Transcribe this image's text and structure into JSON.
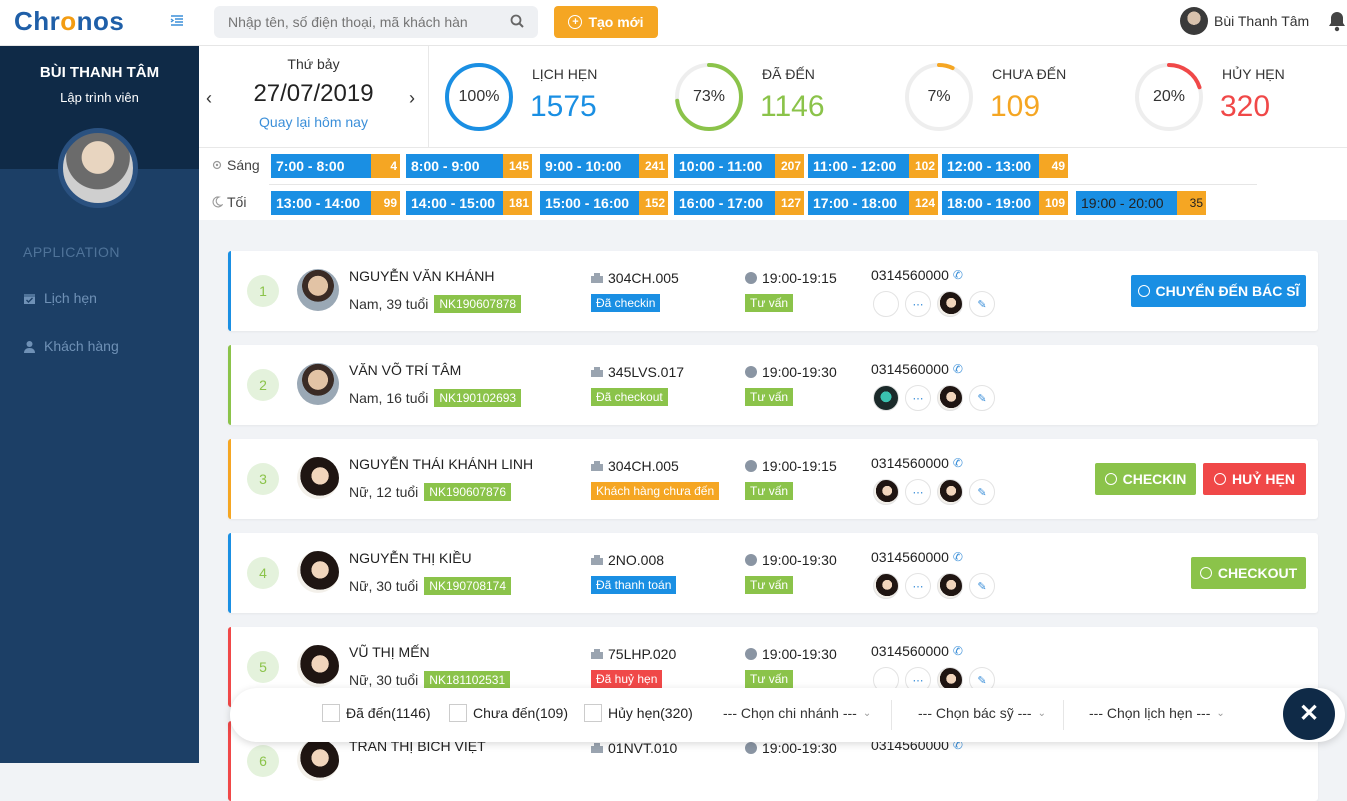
{
  "topbar": {
    "logo_pre": "Chr",
    "logo_o": "o",
    "logo_post": "nos",
    "search_placeholder": "Nhập tên, số điện thoại, mã khách hàn",
    "create_label": "Tạo mới",
    "user_name": "Bùi Thanh Tâm"
  },
  "sidebar": {
    "profile_name": "BÙI THANH TÂM",
    "profile_role": "Lập trình viên",
    "section": "APPLICATION",
    "items": [
      {
        "label": "Lịch hẹn",
        "icon": "calendar-icon"
      },
      {
        "label": "Khách hàng",
        "icon": "user-icon"
      }
    ]
  },
  "date": {
    "day_label": "Thứ bảy",
    "value": "27/07/2019",
    "back_label": "Quay lại hôm nay"
  },
  "stats": [
    {
      "title": "LỊCH HẸN",
      "value": "1575",
      "pct": 100,
      "pct_label": "100%",
      "color": "#1a8fe3"
    },
    {
      "title": "ĐÃ ĐẾN",
      "value": "1146",
      "pct": 73,
      "pct_label": "73%",
      "color": "#8bc34a"
    },
    {
      "title": "CHƯA ĐẾN",
      "value": "109",
      "pct": 7,
      "pct_label": "7%",
      "color": "#f5a623"
    },
    {
      "title": "HỦY HẸN",
      "value": "320",
      "pct": 20,
      "pct_label": "20%",
      "color": "#f04848"
    }
  ],
  "timeslots": {
    "morning_label": "Sáng",
    "evening_label": "Tối",
    "morning": [
      {
        "time": "7:00 - 8:00",
        "count": "4"
      },
      {
        "time": "8:00 - 9:00",
        "count": "145"
      },
      {
        "time": "9:00 - 10:00",
        "count": "241"
      },
      {
        "time": "10:00 - 11:00",
        "count": "207"
      },
      {
        "time": "11:00 - 12:00",
        "count": "102"
      },
      {
        "time": "12:00 - 13:00",
        "count": "49"
      }
    ],
    "evening": [
      {
        "time": "13:00 - 14:00",
        "count": "99"
      },
      {
        "time": "14:00 - 15:00",
        "count": "181"
      },
      {
        "time": "15:00 - 16:00",
        "count": "152"
      },
      {
        "time": "16:00 - 17:00",
        "count": "127"
      },
      {
        "time": "17:00 - 18:00",
        "count": "124"
      },
      {
        "time": "18:00 - 19:00",
        "count": "109"
      },
      {
        "time": "19:00 - 20:00",
        "count": "35"
      }
    ]
  },
  "appointments": [
    {
      "index": "1",
      "name": "NGUYỄN VĂN KHÁNH",
      "info": "Nam, 39 tuổi",
      "code": "NK190607878",
      "room": "304CH.005",
      "status": "Đã checkin",
      "status_color": "#1a8fe3",
      "time": "19:00-19:15",
      "service": "Tư vấn",
      "phone": "0314560000",
      "border": "#1a8fe3",
      "gender": "m"
    },
    {
      "index": "2",
      "name": "VĂN VÕ TRÍ TÂM",
      "info": "Nam, 16 tuổi",
      "code": "NK190102693",
      "room": "345LVS.017",
      "status": "Đã checkout",
      "status_color": "#8bc34a",
      "time": "19:00-19:30",
      "service": "Tư vấn",
      "phone": "0314560000",
      "border": "#8bc34a",
      "gender": "m"
    },
    {
      "index": "3",
      "name": "NGUYỄN THÁI KHÁNH LINH",
      "info": "Nữ, 12 tuổi",
      "code": "NK190607876",
      "room": "304CH.005",
      "status": "Khách hàng chưa đến",
      "status_color": "#f5a623",
      "time": "19:00-19:15",
      "service": "Tư vấn",
      "phone": "0314560000",
      "border": "#f5a623",
      "gender": "f"
    },
    {
      "index": "4",
      "name": "NGUYỄN THỊ KIỀU",
      "info": "Nữ, 30 tuổi",
      "code": "NK190708174",
      "room": "2NO.008",
      "status": "Đã thanh toán",
      "status_color": "#1a8fe3",
      "time": "19:00-19:30",
      "service": "Tư vấn",
      "phone": "0314560000",
      "border": "#1a8fe3",
      "gender": "f"
    },
    {
      "index": "5",
      "name": "VŨ THỊ MẾN",
      "info": "Nữ, 30 tuổi",
      "code": "NK181102531",
      "room": "75LHP.020",
      "status": "Đã huỷ hẹn",
      "status_color": "#f04848",
      "time": "19:00-19:30",
      "service": "Tư vấn",
      "phone": "0314560000",
      "border": "#f04848",
      "gender": "f"
    },
    {
      "index": "6",
      "name": "TRẦN THỊ BÍCH VIỆT",
      "info": "",
      "code": "",
      "room": "01NVT.010",
      "status": "",
      "status_color": "#1a8fe3",
      "time": "19:00-19:30",
      "service": "",
      "phone": "0314560000",
      "border": "#f04848",
      "gender": "f"
    }
  ],
  "actions": {
    "transfer": "CHUYỂN ĐẾN BÁC SĨ",
    "checkin": "CHECKIN",
    "cancel": "HUỶ HẸN",
    "checkout": "CHECKOUT"
  },
  "filters": {
    "arrived": "Đã đến(1146)",
    "not_arrived": "Chưa đến(109)",
    "cancelled": "Hủy hẹn(320)",
    "branch": "--- Chọn chi nhánh ---",
    "doctor": "--- Chọn bác sỹ ---",
    "appointment": "--- Chọn lịch hẹn ---"
  },
  "colors": {
    "primary": "#1a8fe3",
    "accent": "#f5a623",
    "success": "#8bc34a",
    "danger": "#f04848",
    "sidebar": "#1c3f66"
  }
}
